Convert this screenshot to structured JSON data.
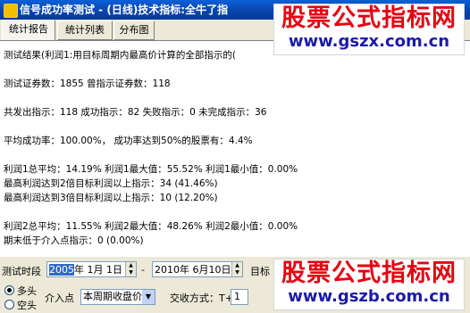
{
  "window": {
    "title": "信号成功率测试 - (日线)技术指标:全牛了指"
  },
  "tabs": [
    {
      "label": "统计报告",
      "active": true
    },
    {
      "label": "统计列表",
      "active": false
    },
    {
      "label": "分布图",
      "active": false
    }
  ],
  "report": {
    "lines": [
      "测试结果(利润1:用目标周期内最高价计算的全部指示的(",
      "测试证券数：1855        曾指示证券数：118",
      "共发出指示：118  成功指示：82  失败指示：0  未完成指示：36",
      "平均成功率：100.00%， 成功率达到50%的股票有：4.4%",
      "利润1总平均：14.19%  利润1最大值：55.52%  利润1最小值：0.00%",
      "最高利润达到2倍目标利润以上指示：34 (41.46%)",
      "最高利润达到3倍目标利润以上指示：10 (12.20%)",
      "利润2总平均：11.55%  利润2最大值：48.26%  利润2最小值：0.00%",
      "期末低于介入点指示：0 (0.00%)"
    ]
  },
  "controls": {
    "period_label": "测试时段",
    "start_year_selected": "2005",
    "start_rest": "年 1月 1日",
    "dash": "-",
    "end_date": "2010年 6月10日",
    "target_label": "目标",
    "radio_long": "多头",
    "radio_short": "空头",
    "entry_label": "介入点",
    "entry_value": "本周期收盘价",
    "trade_label": "交收方式：T+",
    "trade_value": "1"
  },
  "watermarks": [
    {
      "main": "股票公式指标网",
      "url": "www.gszx.com.cn"
    },
    {
      "main": "股票公式指标网",
      "url": "www.gszb.com.cn"
    }
  ],
  "colors": {
    "titlebar": "#0842a8",
    "watermark_red": "#e60012",
    "watermark_blue": "#1a1aa8",
    "selection": "#316ac5"
  }
}
